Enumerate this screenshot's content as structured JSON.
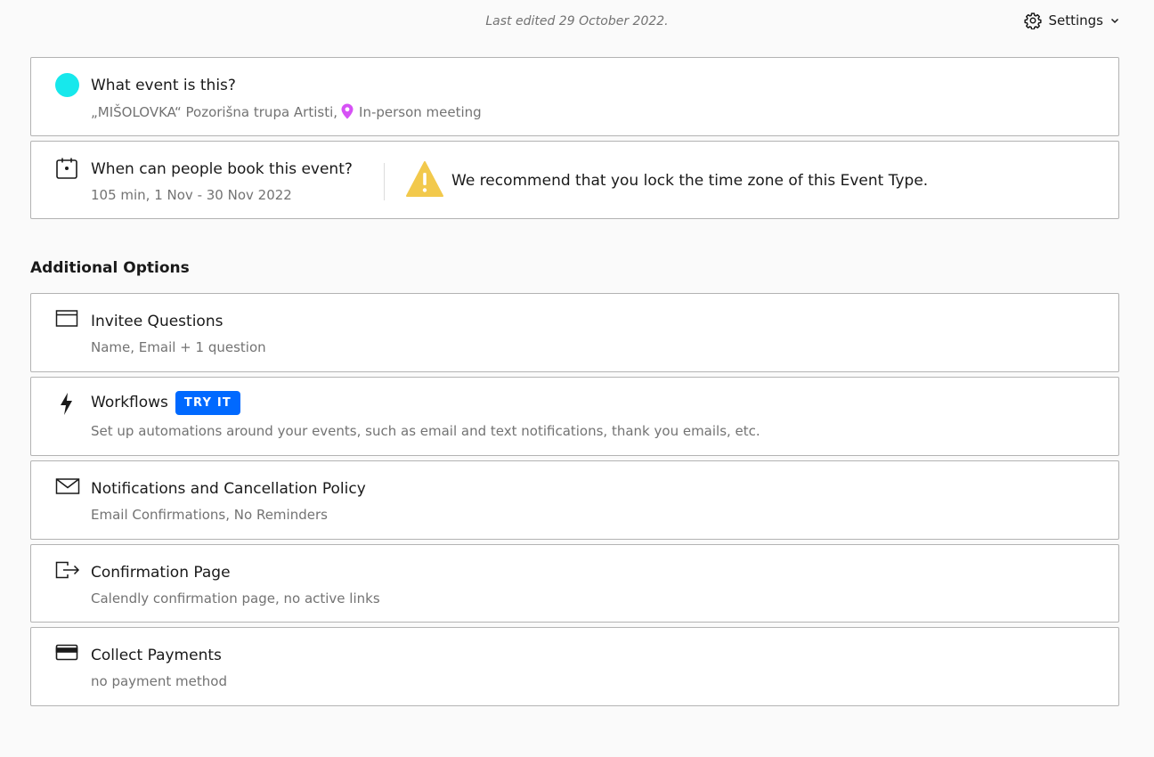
{
  "header": {
    "last_edited": "Last edited 29 October 2022.",
    "settings_label": "Settings",
    "settings_icon": "gear-icon",
    "dropdown_icon": "chevron-down-icon"
  },
  "event_card": {
    "title": "What event is this?",
    "name": "„MIŠOLOVKA“ Pozorišna trupa Artisti,",
    "location": "In-person meeting",
    "color": "#17e8ec",
    "location_icon_color": "#d651f5"
  },
  "schedule_card": {
    "title": "When can people book this event?",
    "subtitle": "105 min, 1 Nov - 30 Nov 2022",
    "warning": "We recommend that you lock the time zone of this Event Type.",
    "warning_color": "#f2c94c"
  },
  "additional": {
    "heading": "Additional Options",
    "items": [
      {
        "title": "Invitee Questions",
        "subtitle": "Name, Email + 1 question",
        "icon": "form-icon"
      },
      {
        "title": "Workflows",
        "badge": "TRY IT",
        "subtitle": "Set up automations around your events, such as email and text notifications, thank you emails, etc.",
        "icon": "lightning-icon"
      },
      {
        "title": "Notifications and Cancellation Policy",
        "subtitle": "Email Confirmations, No Reminders",
        "icon": "envelope-icon"
      },
      {
        "title": "Confirmation Page",
        "subtitle": "Calendly confirmation page, no active links",
        "icon": "redirect-icon"
      },
      {
        "title": "Collect Payments",
        "subtitle": "no payment method",
        "icon": "credit-card-icon"
      }
    ]
  },
  "colors": {
    "accent": "#0069ff",
    "border": "#b3b3b3",
    "background": "#fafafa"
  }
}
